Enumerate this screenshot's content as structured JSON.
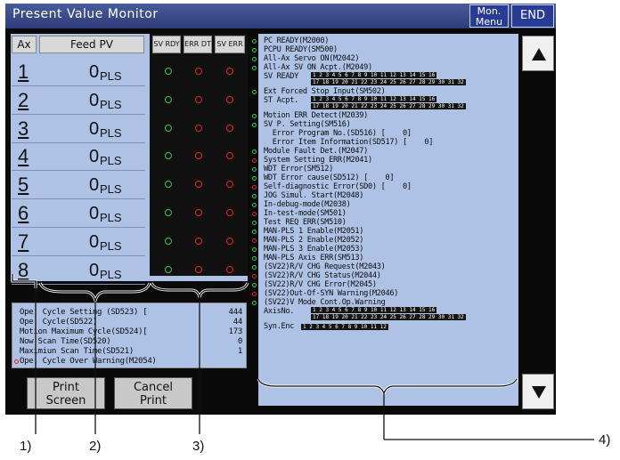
{
  "window": {
    "title": "Present Value Monitor",
    "menu_label_1": "Mon.",
    "menu_label_2": "Menu",
    "end_label": "END"
  },
  "table": {
    "ax_header": "Ax",
    "feed_header": "Feed PV",
    "col_headers": [
      "SV RDY",
      "ERR DT",
      "SV ERR"
    ],
    "rows": [
      {
        "ax": "1",
        "value": "0",
        "unit": "PLS"
      },
      {
        "ax": "2",
        "value": "0",
        "unit": "PLS"
      },
      {
        "ax": "3",
        "value": "0",
        "unit": "PLS"
      },
      {
        "ax": "4",
        "value": "0",
        "unit": "PLS"
      },
      {
        "ax": "5",
        "value": "0",
        "unit": "PLS"
      },
      {
        "ax": "6",
        "value": "0",
        "unit": "PLS"
      },
      {
        "ax": "7",
        "value": "0",
        "unit": "PLS"
      },
      {
        "ax": "8",
        "value": "0",
        "unit": "PLS"
      }
    ]
  },
  "scan": {
    "lines": [
      {
        "label": "Ope. Cycle Setting (SD523) [",
        "value": "444"
      },
      {
        "label": "Ope. Cycle(SD522)",
        "value": "44"
      },
      {
        "label": "Motion Maximum Cycle(SD524)[",
        "value": "173"
      },
      {
        "label": "Now Scan Time(SD520)",
        "value": "0"
      },
      {
        "label": "Maximiun Scan Time(SD521)",
        "value": "1"
      },
      {
        "label": "Ope. Cycle Over Warning(M2054)",
        "value": ""
      }
    ]
  },
  "buttons": {
    "print_1": "Print",
    "print_2": "Screen",
    "cancel_1": "Cancel",
    "cancel_2": "Print"
  },
  "monitor": {
    "lines": [
      "PC READY(M2000)",
      "PCPU READY(SM500)",
      "All-Ax Servo ON(M2042)",
      "All-Ax SV ON Acpt.(M2049)",
      "SV READY",
      "Ext Forced Stop Input(SM502)",
      "ST Acpt.",
      "Motion ERR Detect(M2039)",
      "SV P. Setting(SM516)",
      "  Error Program No.(SD516) [    0]",
      "  Error Item Information(SD517) [    0]",
      "Module Fault Det.(M2047)",
      "System Setting ERR(M2041)",
      "WDT Error(SM512)",
      "WDT Error cause(SD512) [    0]",
      "Self-diagnostic Error(SD0) [    0]",
      "JOG Simul. Start(M2048)",
      "In-debug-mode(M2038)",
      "In-test-mode(SM501)",
      "Test REQ ERR(SM510)",
      "MAN-PLS 1 Enable(M2051)",
      "MAN-PLS 2 Enable(M2052)",
      "MAN-PLS 3 Enable(M2053)",
      "MAN-PLS Axis ERR(SM513)",
      "(SV22)R/V CHG Request(M2043)",
      "(SV22)R/V CHG Status(M2044)",
      "(SV22)R/V CHG Error(M2045)",
      "(SV22)Out-Of-SYN Warning(M2046)",
      "(SV22)V Mode Cont.Op.Warning",
      "AxisNo.",
      "Syn.Enc"
    ],
    "num_row_a": "1 2 3 4 5 6 7 8 9 10 11 12 13 14 15 16",
    "num_row_b": "17 18 19 20 21 22 23 24 25 26 27 28 29 30 31 32",
    "num_syn": "1 2 3 4 5 6 7 8 9 10 11 12"
  },
  "callouts": [
    "1)",
    "2)",
    "3)",
    "4)"
  ]
}
